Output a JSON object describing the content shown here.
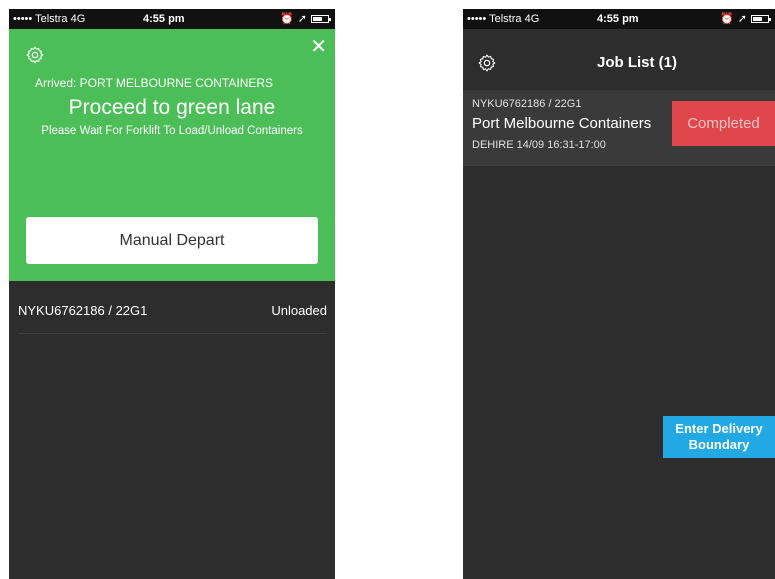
{
  "left_screen": {
    "statusbar": {
      "carrier": "••••• Telstra",
      "network": "4G",
      "time": "4:55 pm"
    },
    "banner": {
      "arrived_text": "Arrived: PORT MELBOURNE CONTAINERS",
      "headline": "Proceed to green lane",
      "instruction": "Please Wait For Forklift To Load/Unload Containers",
      "manual_depart_label": "Manual Depart",
      "background_color": "#4cbe58"
    },
    "containers": [
      {
        "code": "NYKU6762186 / 22G1",
        "status": "Unloaded"
      }
    ]
  },
  "right_screen": {
    "statusbar": {
      "carrier": "••••• Telstra",
      "network": "4G",
      "time": "4:55 pm"
    },
    "title": "Job List (1)",
    "jobs": [
      {
        "code": "NYKU6762186 / 22G1",
        "name": "Port Melbourne Containers",
        "meta": "DEHIRE  14/09 16:31-17:00",
        "status": "Completed",
        "status_color": "#e0474c"
      }
    ],
    "delivery_button_label": "Enter Delivery Boundary",
    "delivery_button_color": "#22a8e3"
  },
  "icons": {
    "settings": "gear-icon",
    "close": "close-icon",
    "battery": "battery-icon",
    "location": "location-arrow-icon",
    "alarm": "alarm-icon"
  }
}
